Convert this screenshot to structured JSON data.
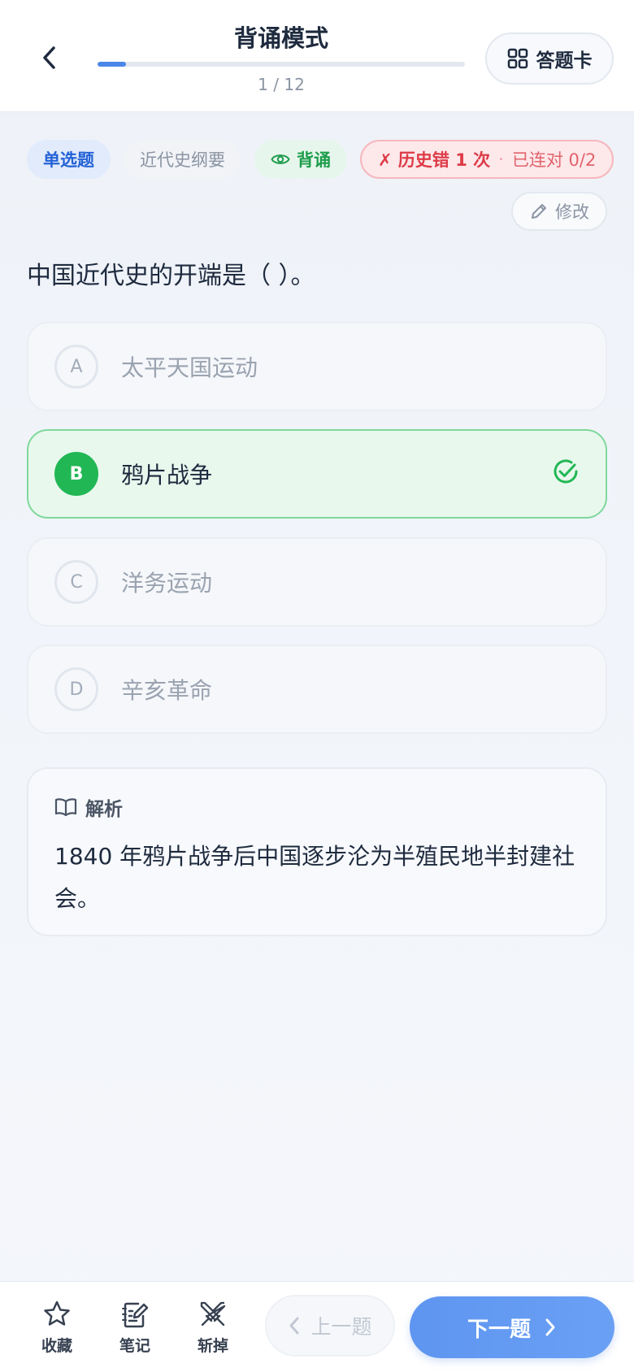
{
  "header": {
    "title": "背诵模式",
    "progress_text": "1 / 12",
    "progress_fraction": 0.077,
    "answer_card_label": "答题卡"
  },
  "tags": {
    "type": "单选题",
    "subject": "近代史纲要",
    "mode": "背诵",
    "history_error": "✗ 历史错 1 次",
    "separator": "·",
    "streak": "已连对 0/2"
  },
  "edit_label": "修改",
  "question": "中国近代史的开端是（ ）。",
  "options": [
    {
      "letter": "A",
      "text": "太平天国运动"
    },
    {
      "letter": "B",
      "text": "鸦片战争"
    },
    {
      "letter": "C",
      "text": "洋务运动"
    },
    {
      "letter": "D",
      "text": "辛亥革命"
    }
  ],
  "analysis": {
    "heading": "解析",
    "body": "1840 年鸦片战争后中国逐步沦为半殖民地半封建社会。"
  },
  "bottom": {
    "favorite": "收藏",
    "note": "笔记",
    "remove": "斩掉",
    "prev": "上一题",
    "next": "下一题"
  },
  "colors": {
    "accent": "#4a86e8",
    "correct": "#22b755",
    "error": "#dc3b47"
  }
}
